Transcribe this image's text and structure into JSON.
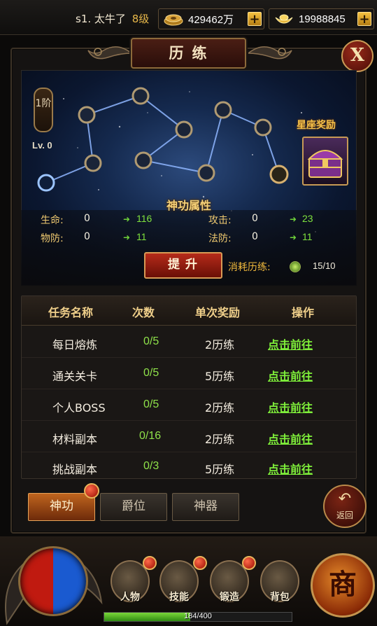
{
  "topbar": {
    "player_name": "s1. 太牛了",
    "player_level": "8级",
    "gold_value": "429462万",
    "ingot_value": "19988845",
    "gold_icon": "gold-coins-icon",
    "ingot_icon": "gold-ingot-icon"
  },
  "panel": {
    "title": "历练",
    "close_label": "X"
  },
  "constellation": {
    "rank_label": "1阶",
    "level_label": "Lv. 0",
    "reward_label": "星座奖励",
    "attr_title": "神功属性"
  },
  "attributes": [
    {
      "name": "生命:",
      "value": "0",
      "gain": "116"
    },
    {
      "name": "物防:",
      "value": "0",
      "gain": "11"
    },
    {
      "name": "攻击:",
      "value": "0",
      "gain": "23"
    },
    {
      "name": "法防:",
      "value": "0",
      "gain": "11"
    }
  ],
  "upgrade": {
    "button_label": "提升",
    "cost_label": "消耗历练:",
    "cost_value": "15/10"
  },
  "tasks": {
    "headers": [
      "任务名称",
      "次数",
      "单次奖励",
      "操作"
    ],
    "rows": [
      {
        "name": "每日熔炼",
        "count": "0/5",
        "reward": "2历练",
        "action": "点击前往"
      },
      {
        "name": "通关关卡",
        "count": "0/5",
        "reward": "5历练",
        "action": "点击前往"
      },
      {
        "name": "个人BOSS",
        "count": "0/5",
        "reward": "2历练",
        "action": "点击前往"
      },
      {
        "name": "材料副本",
        "count": "0/16",
        "reward": "2历练",
        "action": "点击前往"
      },
      {
        "name": "挑战副本",
        "count": "0/3",
        "reward": "5历练",
        "action": "点击前往"
      }
    ]
  },
  "tabs": [
    {
      "label": "神功",
      "active": true
    },
    {
      "label": "爵位",
      "active": false
    },
    {
      "label": "神器",
      "active": false
    }
  ],
  "back_label": "返回",
  "bottom_menu": [
    {
      "label": "人物",
      "icon": "character-icon"
    },
    {
      "label": "技能",
      "icon": "skill-icon"
    },
    {
      "label": "锻造",
      "icon": "forge-icon"
    },
    {
      "label": "背包",
      "icon": "backpack-icon"
    }
  ],
  "shop_label": "商",
  "exp": {
    "text": "184/400",
    "fraction": 0.46
  }
}
